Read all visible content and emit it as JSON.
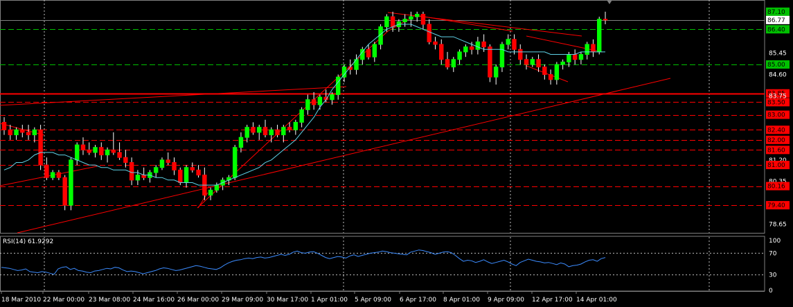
{
  "chart_data": [
    {
      "type": "candlestick",
      "symbol": "",
      "ylim": [
        78.3,
        87.4
      ],
      "y_ticks": [
        "87.10",
        "86.77",
        "86.40",
        "85.45",
        "85.00",
        "84.60",
        "83.85",
        "83.75",
        "83.50",
        "83.00",
        "82.40",
        "82.00",
        "81.60",
        "81.20",
        "81.00",
        "80.35",
        "80.16",
        "79.40",
        "78.65"
      ],
      "y_tick_values": [
        87.1,
        86.77,
        86.4,
        85.45,
        85.0,
        84.6,
        83.85,
        83.75,
        83.5,
        83.0,
        82.4,
        82.0,
        81.6,
        81.2,
        81.0,
        80.35,
        80.16,
        79.4,
        78.65
      ],
      "x_labels": [
        "18 Mar 2010",
        "22 Mar 00:00",
        "23 Mar 08:00",
        "24 Mar 16:00",
        "26 Mar 00:00",
        "29 Mar 09:00",
        "30 Mar 17:00",
        "1 Apr 01:00",
        "5 Apr 09:00",
        "6 Apr 17:00",
        "8 Apr 01:00",
        "9 Apr 09:00",
        "12 Apr 17:00",
        "14 Apr 01:00"
      ],
      "current_price": 86.77,
      "current_price_label": "86.77",
      "highlight_levels": [
        {
          "label": "87.10",
          "value": 87.1,
          "color": "#00c000"
        },
        {
          "label": "86.40",
          "value": 86.4,
          "color": "#00c000",
          "line": "dashed"
        },
        {
          "label": "85.00",
          "value": 85.0,
          "color": "#00c000",
          "line": "dashed"
        },
        {
          "label": "83.85",
          "value": 83.85,
          "color": "#ff0000",
          "line": "solid"
        },
        {
          "label": "83.50",
          "value": 83.5,
          "color": "#ff0000",
          "line": "dashed"
        },
        {
          "label": "83.00",
          "value": 83.0,
          "color": "#ff0000",
          "line": "dashed"
        },
        {
          "label": "82.40",
          "value": 82.4,
          "color": "#ff0000",
          "line": "dashed"
        },
        {
          "label": "82.00",
          "value": 82.0,
          "color": "#ff0000",
          "line": "dashed"
        },
        {
          "label": "81.60",
          "value": 81.6,
          "color": "#ff0000",
          "line": "dashed"
        },
        {
          "label": "81.00",
          "value": 81.0,
          "color": "#ff0000",
          "line": "dashed"
        },
        {
          "label": "80.16",
          "value": 80.16,
          "color": "#ff0000",
          "line": "dashed"
        },
        {
          "label": "79.40",
          "value": 79.4,
          "color": "#ff0000",
          "line": "dashed"
        }
      ],
      "moving_average": [
        80.8,
        80.9,
        81.1,
        81.1,
        81.2,
        81.4,
        81.5,
        81.5,
        81.5,
        81.4,
        81.4,
        81.3,
        81.2,
        81.1,
        81.0,
        81.0,
        80.9,
        80.9,
        80.8,
        80.8,
        80.8,
        80.7,
        80.7,
        80.6,
        80.6,
        80.5,
        80.5,
        80.4,
        80.4,
        80.3,
        80.3,
        80.3,
        80.2,
        80.2,
        80.2,
        80.2,
        80.3,
        80.4,
        80.5,
        80.6,
        80.7,
        80.8,
        80.9,
        81.1,
        81.2,
        81.4,
        81.6,
        81.8,
        82.0,
        82.3,
        82.6,
        82.9,
        83.3,
        83.6,
        84.0,
        84.3,
        84.6,
        84.9,
        85.2,
        85.5,
        85.8,
        86.0,
        86.2,
        86.4,
        86.5,
        86.6,
        86.6,
        86.6,
        86.5,
        86.4,
        86.3,
        86.2,
        86.1,
        86.1,
        86.1,
        86.0,
        85.9,
        85.8,
        85.7,
        85.6,
        85.6,
        85.6,
        85.6,
        85.5,
        85.5,
        85.5,
        85.5,
        85.5,
        85.5,
        85.5,
        85.4,
        85.4,
        85.4,
        85.4,
        85.4,
        85.5,
        85.5,
        85.5,
        85.5,
        85.5
      ],
      "candles": [
        {
          "o": 82.7,
          "h": 82.9,
          "l": 82.2,
          "c": 82.4
        },
        {
          "o": 82.4,
          "h": 82.6,
          "l": 82.0,
          "c": 82.2
        },
        {
          "o": 82.2,
          "h": 82.5,
          "l": 82.0,
          "c": 82.4
        },
        {
          "o": 82.4,
          "h": 82.6,
          "l": 82.1,
          "c": 82.3
        },
        {
          "o": 82.3,
          "h": 82.6,
          "l": 82.0,
          "c": 82.2
        },
        {
          "o": 82.2,
          "h": 82.5,
          "l": 81.9,
          "c": 82.4
        },
        {
          "o": 82.4,
          "h": 82.6,
          "l": 80.8,
          "c": 81.0
        },
        {
          "o": 81.0,
          "h": 81.3,
          "l": 80.4,
          "c": 80.5
        },
        {
          "o": 80.5,
          "h": 80.8,
          "l": 80.4,
          "c": 80.7
        },
        {
          "o": 80.7,
          "h": 80.8,
          "l": 80.4,
          "c": 80.5
        },
        {
          "o": 80.5,
          "h": 80.6,
          "l": 79.2,
          "c": 79.4
        },
        {
          "o": 79.4,
          "h": 81.3,
          "l": 79.2,
          "c": 81.2
        },
        {
          "o": 81.2,
          "h": 81.9,
          "l": 81.0,
          "c": 81.8
        },
        {
          "o": 81.8,
          "h": 82.1,
          "l": 81.4,
          "c": 81.6
        },
        {
          "o": 81.6,
          "h": 81.9,
          "l": 81.4,
          "c": 81.5
        },
        {
          "o": 81.5,
          "h": 81.8,
          "l": 81.3,
          "c": 81.7
        },
        {
          "o": 81.7,
          "h": 81.9,
          "l": 81.2,
          "c": 81.4
        },
        {
          "o": 81.4,
          "h": 81.7,
          "l": 81.1,
          "c": 81.6
        },
        {
          "o": 81.6,
          "h": 82.3,
          "l": 81.4,
          "c": 81.5
        },
        {
          "o": 81.5,
          "h": 81.9,
          "l": 81.2,
          "c": 81.3
        },
        {
          "o": 81.3,
          "h": 81.6,
          "l": 80.9,
          "c": 81.1
        },
        {
          "o": 81.1,
          "h": 81.3,
          "l": 80.2,
          "c": 80.4
        },
        {
          "o": 80.4,
          "h": 80.8,
          "l": 80.2,
          "c": 80.6
        },
        {
          "o": 80.6,
          "h": 80.9,
          "l": 80.4,
          "c": 80.5
        },
        {
          "o": 80.5,
          "h": 80.8,
          "l": 80.3,
          "c": 80.7
        },
        {
          "o": 80.7,
          "h": 81.0,
          "l": 80.5,
          "c": 80.9
        },
        {
          "o": 80.9,
          "h": 81.3,
          "l": 80.8,
          "c": 81.2
        },
        {
          "o": 81.2,
          "h": 81.5,
          "l": 81.0,
          "c": 81.1
        },
        {
          "o": 81.1,
          "h": 81.3,
          "l": 80.6,
          "c": 80.8
        },
        {
          "o": 80.8,
          "h": 80.9,
          "l": 80.2,
          "c": 80.3
        },
        {
          "o": 80.3,
          "h": 81.0,
          "l": 80.1,
          "c": 80.9
        },
        {
          "o": 80.9,
          "h": 81.1,
          "l": 80.7,
          "c": 80.8
        },
        {
          "o": 80.8,
          "h": 81.0,
          "l": 80.5,
          "c": 80.6
        },
        {
          "o": 80.6,
          "h": 80.9,
          "l": 79.6,
          "c": 79.8
        },
        {
          "o": 79.8,
          "h": 80.1,
          "l": 79.6,
          "c": 80.0
        },
        {
          "o": 80.0,
          "h": 80.3,
          "l": 79.9,
          "c": 80.2
        },
        {
          "o": 80.2,
          "h": 80.5,
          "l": 80.0,
          "c": 80.4
        },
        {
          "o": 80.4,
          "h": 80.6,
          "l": 80.2,
          "c": 80.5
        },
        {
          "o": 80.5,
          "h": 81.8,
          "l": 80.4,
          "c": 81.7
        },
        {
          "o": 81.7,
          "h": 82.3,
          "l": 81.5,
          "c": 82.1
        },
        {
          "o": 82.1,
          "h": 82.6,
          "l": 81.9,
          "c": 82.5
        },
        {
          "o": 82.5,
          "h": 82.7,
          "l": 82.2,
          "c": 82.3
        },
        {
          "o": 82.3,
          "h": 82.6,
          "l": 82.0,
          "c": 82.5
        },
        {
          "o": 82.5,
          "h": 82.8,
          "l": 82.1,
          "c": 82.2
        },
        {
          "o": 82.2,
          "h": 82.5,
          "l": 81.9,
          "c": 82.4
        },
        {
          "o": 82.4,
          "h": 82.6,
          "l": 82.1,
          "c": 82.2
        },
        {
          "o": 82.2,
          "h": 82.6,
          "l": 81.9,
          "c": 82.5
        },
        {
          "o": 82.5,
          "h": 82.7,
          "l": 82.3,
          "c": 82.4
        },
        {
          "o": 82.4,
          "h": 82.8,
          "l": 82.2,
          "c": 82.7
        },
        {
          "o": 82.7,
          "h": 83.3,
          "l": 82.5,
          "c": 83.2
        },
        {
          "o": 83.2,
          "h": 83.8,
          "l": 83.0,
          "c": 83.6
        },
        {
          "o": 83.6,
          "h": 83.9,
          "l": 83.2,
          "c": 83.4
        },
        {
          "o": 83.4,
          "h": 83.8,
          "l": 83.2,
          "c": 83.7
        },
        {
          "o": 83.7,
          "h": 84.0,
          "l": 83.5,
          "c": 83.6
        },
        {
          "o": 83.6,
          "h": 83.9,
          "l": 83.4,
          "c": 83.8
        },
        {
          "o": 83.8,
          "h": 84.6,
          "l": 83.6,
          "c": 84.5
        },
        {
          "o": 84.5,
          "h": 85.0,
          "l": 84.3,
          "c": 84.9
        },
        {
          "o": 84.9,
          "h": 85.2,
          "l": 84.6,
          "c": 84.8
        },
        {
          "o": 84.8,
          "h": 85.4,
          "l": 84.6,
          "c": 85.2
        },
        {
          "o": 85.2,
          "h": 85.7,
          "l": 85.0,
          "c": 85.6
        },
        {
          "o": 85.6,
          "h": 85.8,
          "l": 85.2,
          "c": 85.3
        },
        {
          "o": 85.3,
          "h": 85.9,
          "l": 85.1,
          "c": 85.8
        },
        {
          "o": 85.8,
          "h": 86.6,
          "l": 85.6,
          "c": 86.5
        },
        {
          "o": 86.5,
          "h": 87.0,
          "l": 86.3,
          "c": 86.9
        },
        {
          "o": 86.9,
          "h": 87.1,
          "l": 86.3,
          "c": 86.5
        },
        {
          "o": 86.5,
          "h": 86.8,
          "l": 86.3,
          "c": 86.7
        },
        {
          "o": 86.7,
          "h": 87.0,
          "l": 86.5,
          "c": 86.8
        },
        {
          "o": 86.8,
          "h": 87.1,
          "l": 86.5,
          "c": 86.9
        },
        {
          "o": 86.9,
          "h": 87.1,
          "l": 86.7,
          "c": 87.0
        },
        {
          "o": 87.0,
          "h": 87.1,
          "l": 86.4,
          "c": 86.6
        },
        {
          "o": 86.6,
          "h": 86.8,
          "l": 85.8,
          "c": 85.9
        },
        {
          "o": 85.9,
          "h": 86.1,
          "l": 85.6,
          "c": 85.8
        },
        {
          "o": 85.8,
          "h": 86.0,
          "l": 85.0,
          "c": 85.2
        },
        {
          "o": 85.2,
          "h": 85.5,
          "l": 84.8,
          "c": 84.9
        },
        {
          "o": 84.9,
          "h": 85.3,
          "l": 84.7,
          "c": 85.2
        },
        {
          "o": 85.2,
          "h": 85.6,
          "l": 85.0,
          "c": 85.5
        },
        {
          "o": 85.5,
          "h": 85.8,
          "l": 85.3,
          "c": 85.7
        },
        {
          "o": 85.7,
          "h": 85.9,
          "l": 85.4,
          "c": 85.6
        },
        {
          "o": 85.6,
          "h": 86.1,
          "l": 85.4,
          "c": 85.9
        },
        {
          "o": 85.9,
          "h": 86.2,
          "l": 85.5,
          "c": 85.7
        },
        {
          "o": 85.7,
          "h": 85.8,
          "l": 84.3,
          "c": 84.5
        },
        {
          "o": 84.5,
          "h": 85.0,
          "l": 84.2,
          "c": 84.9
        },
        {
          "o": 84.9,
          "h": 85.9,
          "l": 84.7,
          "c": 85.8
        },
        {
          "o": 85.8,
          "h": 86.2,
          "l": 85.6,
          "c": 86.0
        },
        {
          "o": 86.0,
          "h": 86.2,
          "l": 85.4,
          "c": 85.6
        },
        {
          "o": 85.6,
          "h": 85.8,
          "l": 85.0,
          "c": 85.2
        },
        {
          "o": 85.2,
          "h": 85.4,
          "l": 84.8,
          "c": 85.0
        },
        {
          "o": 85.0,
          "h": 85.3,
          "l": 84.9,
          "c": 85.2
        },
        {
          "o": 85.2,
          "h": 85.4,
          "l": 84.7,
          "c": 84.9
        },
        {
          "o": 84.9,
          "h": 85.0,
          "l": 84.4,
          "c": 84.6
        },
        {
          "o": 84.6,
          "h": 84.8,
          "l": 84.2,
          "c": 84.4
        },
        {
          "o": 84.4,
          "h": 85.1,
          "l": 84.2,
          "c": 85.0
        },
        {
          "o": 85.0,
          "h": 85.2,
          "l": 84.8,
          "c": 85.1
        },
        {
          "o": 85.1,
          "h": 85.5,
          "l": 84.9,
          "c": 85.4
        },
        {
          "o": 85.4,
          "h": 85.6,
          "l": 85.0,
          "c": 85.2
        },
        {
          "o": 85.2,
          "h": 85.5,
          "l": 85.0,
          "c": 85.4
        },
        {
          "o": 85.4,
          "h": 85.9,
          "l": 85.2,
          "c": 85.8
        },
        {
          "o": 85.8,
          "h": 86.0,
          "l": 85.3,
          "c": 85.5
        },
        {
          "o": 85.5,
          "h": 86.9,
          "l": 85.4,
          "c": 86.8
        },
        {
          "o": 86.8,
          "h": 87.1,
          "l": 86.6,
          "c": 86.77
        }
      ]
    },
    {
      "type": "line",
      "title": "RSI(14) 61.9292",
      "ylim": [
        0,
        100
      ],
      "y_ticks": [
        "100",
        "70",
        "30",
        "0"
      ],
      "y_tick_values": [
        100,
        70,
        30,
        0
      ],
      "levels": [
        70,
        30
      ],
      "values": [
        44,
        43,
        42,
        40,
        38,
        39,
        41,
        36,
        35,
        34,
        36,
        35,
        33,
        31,
        41,
        44,
        45,
        40,
        42,
        38,
        37,
        35,
        34,
        37,
        38,
        40,
        42,
        41,
        44,
        43,
        39,
        36,
        37,
        36,
        34,
        32,
        34,
        36,
        38,
        41,
        43,
        42,
        40,
        38,
        39,
        41,
        43,
        45,
        47,
        46,
        44,
        42,
        41,
        40,
        43,
        48,
        52,
        55,
        57,
        58,
        60,
        61,
        60,
        62,
        63,
        61,
        62,
        64,
        66,
        68,
        66,
        68,
        72,
        74,
        71,
        70,
        72,
        73,
        70,
        66,
        62,
        60,
        62,
        64,
        63,
        61,
        65,
        67,
        64,
        66,
        68,
        70,
        71,
        72,
        74,
        73,
        71,
        70,
        69,
        68,
        67,
        72,
        74,
        76,
        75,
        73,
        71,
        68,
        70,
        72,
        73,
        71,
        66,
        60,
        55,
        57,
        56,
        53,
        55,
        58,
        54,
        51,
        53,
        55,
        57,
        54,
        50,
        47,
        53,
        56,
        59,
        57,
        55,
        54,
        52,
        53,
        51,
        49,
        52,
        50,
        45,
        47,
        48,
        50,
        54,
        57,
        58,
        55,
        60,
        62
      ]
    }
  ]
}
